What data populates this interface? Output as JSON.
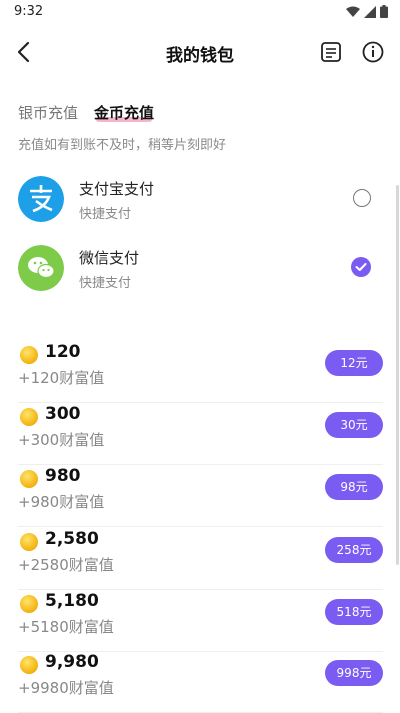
{
  "status": {
    "time": "9:32"
  },
  "header": {
    "title": "我的钱包",
    "back_icon": "back-arrow-icon",
    "records_icon": "records-icon",
    "info_icon": "info-icon"
  },
  "tabs": [
    {
      "label": "银币充值",
      "active": false
    },
    {
      "label": "金币充值",
      "active": true
    }
  ],
  "notice": "充值如有到账不及时，稍等片刻即好",
  "payment_methods": [
    {
      "name": "支付宝支付",
      "subtitle": "快捷支付",
      "selected": false,
      "color": "#1ea0e8"
    },
    {
      "name": "微信支付",
      "subtitle": "快捷支付",
      "selected": true,
      "color": "#7ecb4a"
    }
  ],
  "packages": [
    {
      "amount": "120",
      "wealth": "+120财富值",
      "price": "12元"
    },
    {
      "amount": "300",
      "wealth": "+300财富值",
      "price": "30元"
    },
    {
      "amount": "980",
      "wealth": "+980财富值",
      "price": "98元"
    },
    {
      "amount": "2,580",
      "wealth": "+2580财富值",
      "price": "258元"
    },
    {
      "amount": "5,180",
      "wealth": "+5180财富值",
      "price": "518元"
    },
    {
      "amount": "9,980",
      "wealth": "+9980财富值",
      "price": "998元"
    }
  ],
  "accent_color": "#7b5cf2"
}
